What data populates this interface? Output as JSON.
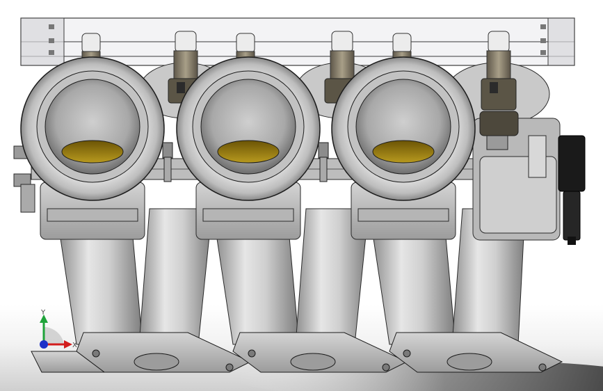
{
  "viewport": {
    "background": "#ffffff",
    "model_color": "#c4c4c4",
    "edge_color": "#1c1c1c",
    "throat_color": "#a8860e",
    "connector_color": "#1a1a1a"
  },
  "triad": {
    "x_label": "X",
    "y_label": "Y",
    "x_color": "#d21c1c",
    "y_color": "#1fa33a",
    "z_color": "#1c30c8"
  },
  "model": {
    "runner_count": 6,
    "trumpet_count": 3,
    "injector_count": 6
  }
}
